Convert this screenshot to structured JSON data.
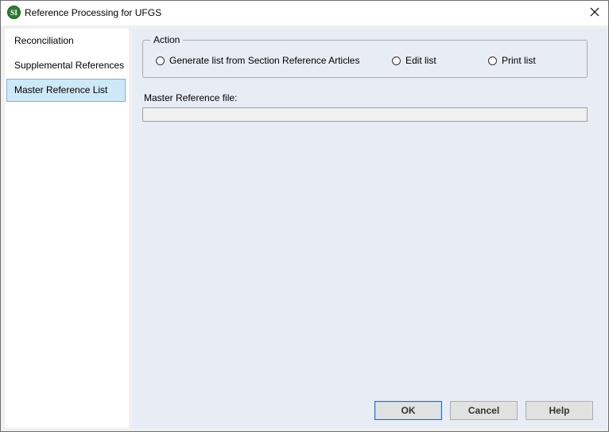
{
  "window": {
    "title": "Reference Processing for UFGS",
    "icon": "si-logo-icon",
    "icon_text": "SI",
    "close_glyph": "✕"
  },
  "sidebar": {
    "items": [
      {
        "label": "Reconciliation",
        "selected": false
      },
      {
        "label": "Supplemental References",
        "selected": false
      },
      {
        "label": "Master Reference List",
        "selected": true
      }
    ]
  },
  "action_group": {
    "legend": "Action",
    "options": [
      {
        "label": "Generate list from Section Reference Articles",
        "checked": false
      },
      {
        "label": "Edit list",
        "checked": false
      },
      {
        "label": "Print list",
        "checked": false
      }
    ]
  },
  "master_file": {
    "label": "Master Reference file:",
    "value": ""
  },
  "buttons": {
    "ok": "OK",
    "cancel": "Cancel",
    "help": "Help"
  },
  "colors": {
    "selected_bg": "#cde8f7",
    "panel_bg": "#e8ecf5",
    "accent": "#0078d7"
  }
}
